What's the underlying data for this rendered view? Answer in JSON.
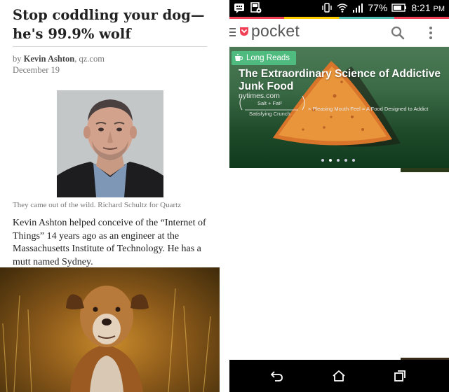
{
  "article": {
    "headline": "Stop coddling your dog—he's 99.9% wolf",
    "byline_prefix": "by ",
    "author": "Kevin Ashton",
    "byline_source": ", qz.com",
    "date": "December 19",
    "caption": "They came out of the wild. Richard Schultz for Quartz",
    "body": "Kevin Ashton helped conceive of the “Internet of Things” 14 years ago as an engineer at the Massachusetts Institute of Technology. He has a mutt named Sydney."
  },
  "status_bar": {
    "battery": "77%",
    "time": "8:21",
    "ampm": "PM",
    "icons": [
      "notification-icon",
      "settings-app-icon",
      "vibrate-icon",
      "wifi-icon",
      "signal-icon",
      "battery-icon"
    ]
  },
  "app": {
    "brand": "pocket",
    "accent": "#ef4056",
    "chip_color": "#50bb7f"
  },
  "hero": {
    "tag": "Long Reads",
    "title": "The Extraordinary Science of Addictive Junk Food",
    "source": "nytimes.com",
    "diagram_text_1": "Salt + Fat²",
    "diagram_text_2": "Satisfying Crunch",
    "diagram_text_3": "× Pleasing Mouth Feel = A Food Designed to Addict",
    "dots_total": 5,
    "dots_active_index": 1
  }
}
